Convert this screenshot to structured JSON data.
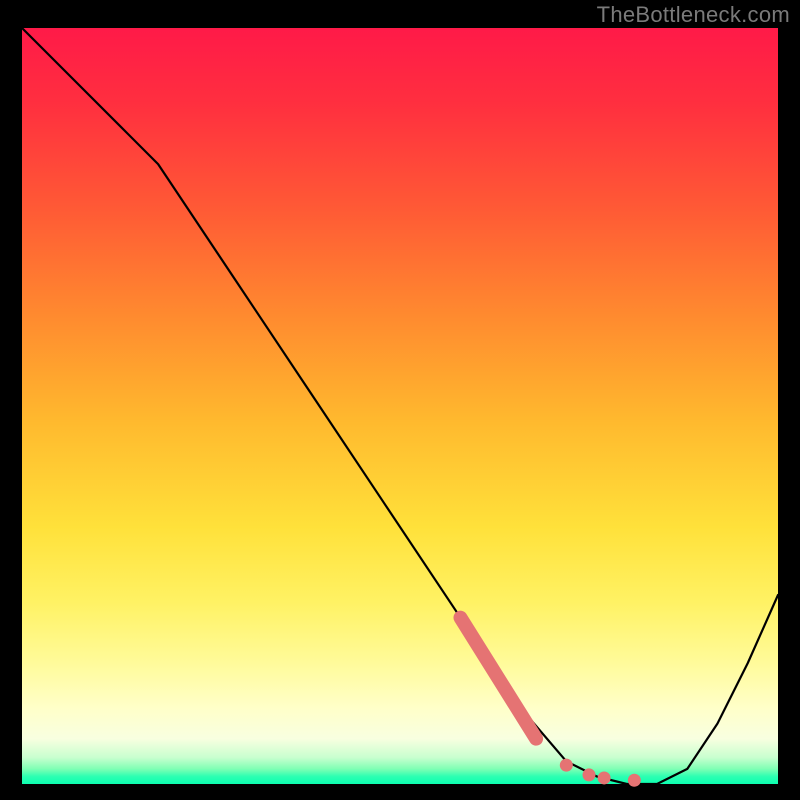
{
  "watermark": "TheBottleneck.com",
  "colors": {
    "highlight": "#e57373",
    "curve": "#000000"
  },
  "chart_data": {
    "type": "line",
    "title": "",
    "xlabel": "",
    "ylabel": "",
    "xlim": [
      0,
      100
    ],
    "ylim": [
      0,
      100
    ],
    "grid": false,
    "legend": false,
    "series": [
      {
        "name": "bottleneck-curve",
        "x": [
          0,
          8,
          18,
          28,
          38,
          48,
          58,
          66,
          72,
          76,
          80,
          84,
          88,
          92,
          96,
          100
        ],
        "y": [
          100,
          92,
          82,
          67,
          52,
          37,
          22,
          10,
          3,
          1,
          0,
          0,
          2,
          8,
          16,
          25
        ]
      }
    ],
    "highlight_segment": {
      "x0": 58,
      "y0": 22,
      "x1": 68,
      "y1": 6
    },
    "valley_dots": [
      {
        "x": 72,
        "y": 2.5
      },
      {
        "x": 75,
        "y": 1.2
      },
      {
        "x": 77,
        "y": 0.8
      },
      {
        "x": 81,
        "y": 0.5
      }
    ]
  }
}
